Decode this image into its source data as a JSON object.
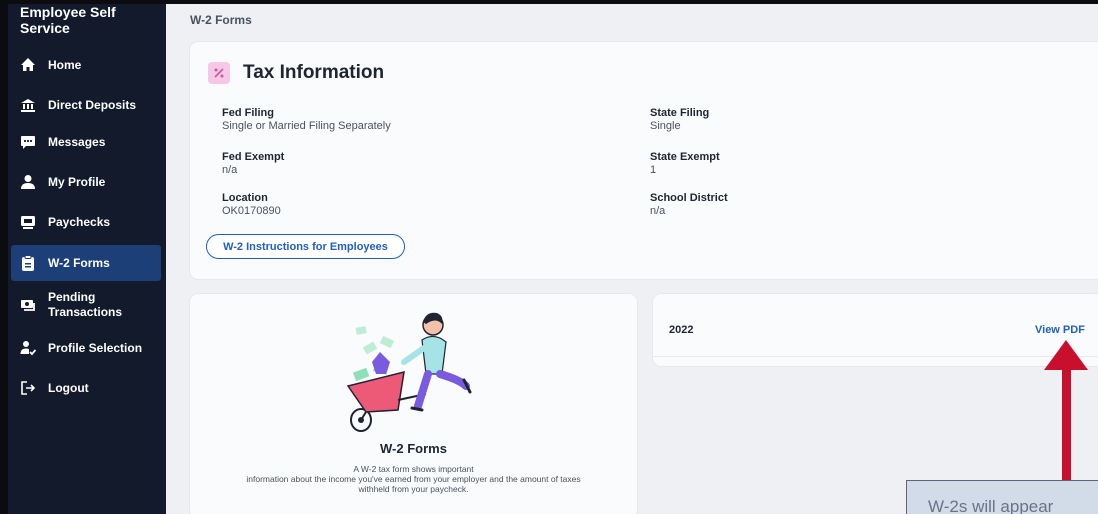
{
  "sidebar": {
    "brand": "Employee Self Service",
    "items": [
      {
        "label": "Home",
        "icon": "home-icon"
      },
      {
        "label": "Direct Deposits",
        "icon": "bank-icon"
      },
      {
        "label": "Messages",
        "icon": "chat-icon"
      },
      {
        "label": "My Profile",
        "icon": "user-icon"
      },
      {
        "label": "Paychecks",
        "icon": "paycheck-icon"
      },
      {
        "label": "W-2 Forms",
        "icon": "clipboard-icon",
        "active": true
      },
      {
        "label": "Pending Transactions",
        "icon": "money-icon"
      },
      {
        "label": "Profile Selection",
        "icon": "user-check-icon"
      },
      {
        "label": "Logout",
        "icon": "logout-icon"
      }
    ]
  },
  "page": {
    "title": "W-2 Forms"
  },
  "tax": {
    "heading": "Tax Information",
    "fed_filing": {
      "label": "Fed Filing",
      "value": "Single or Married Filing Separately"
    },
    "state_filing": {
      "label": "State Filing",
      "value": "Single"
    },
    "fed_exempt": {
      "label": "Fed Exempt",
      "value": "n/a"
    },
    "state_exempt": {
      "label": "State Exempt",
      "value": "1"
    },
    "location": {
      "label": "Location",
      "value": "OK0170890"
    },
    "school_district": {
      "label": "School District",
      "value": "n/a"
    },
    "instructions_button": "W-2 Instructions for Employees"
  },
  "w2_info": {
    "title": "W-2 Forms",
    "description_line1": "A W-2 tax form shows important",
    "description_line2": "information about the income you've earned from your employer and the amount of taxes",
    "description_line3": "withheld from your paycheck."
  },
  "forms": [
    {
      "year": "2022",
      "action": "View PDF"
    }
  ],
  "annotation": {
    "callout_text": "W-2s will appear",
    "arrow_color": "#c8102e"
  },
  "colors": {
    "sidebar": "#121a2c",
    "active": "#1c3f77",
    "accent": "#1f5fbf"
  }
}
